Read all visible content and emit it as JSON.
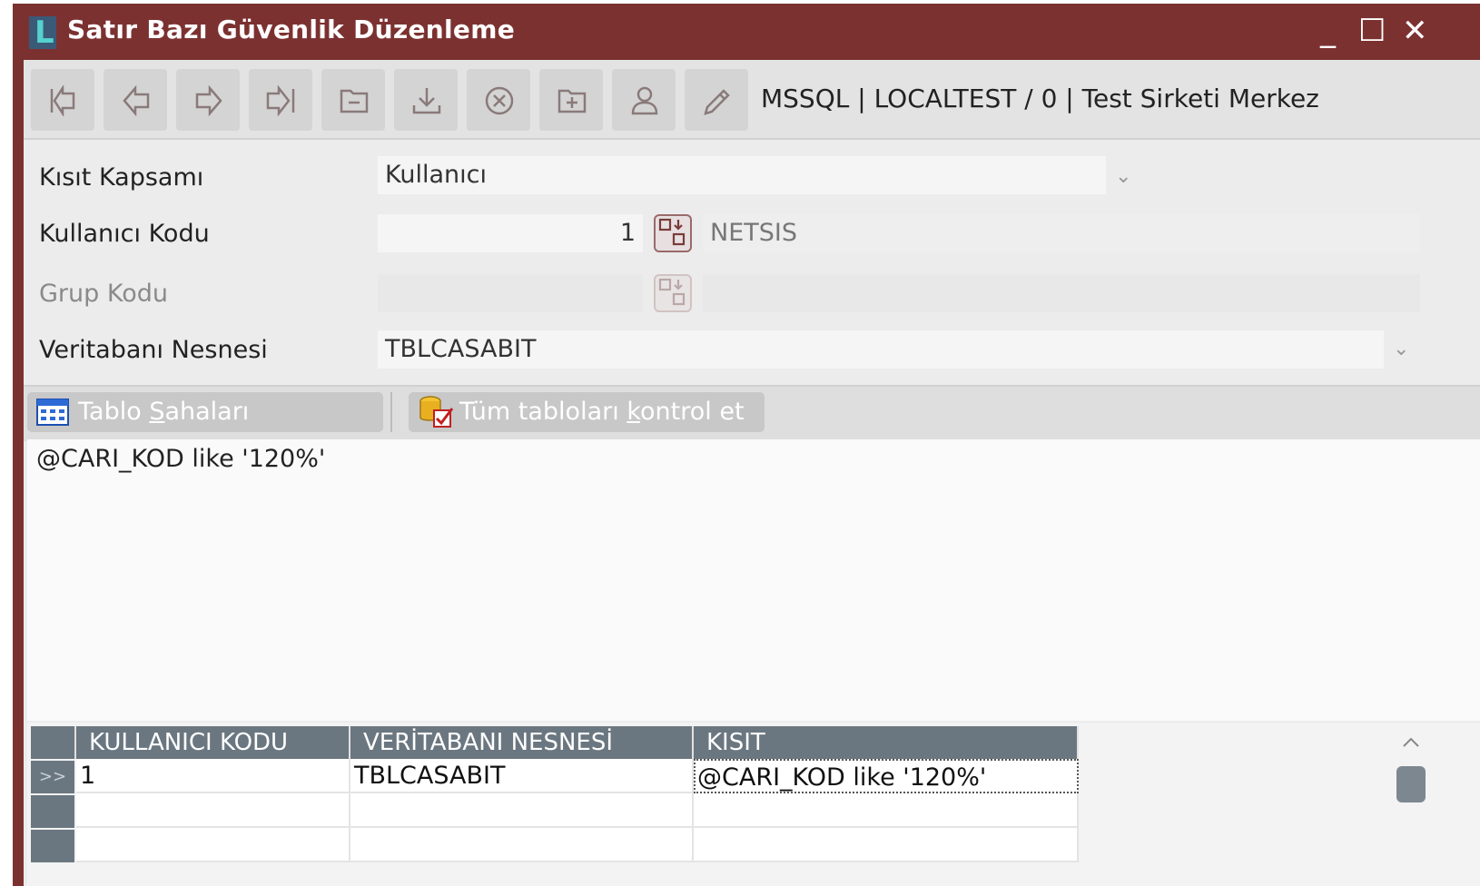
{
  "window": {
    "title": "Satır Bazı Güvenlik Düzenleme",
    "app_logo_letter": "L",
    "controls": {
      "minimize": "_",
      "maximize": "☐",
      "close": "✕"
    }
  },
  "toolbar": {
    "buttons": [
      {
        "name": "first-record",
        "icon": "first-icon"
      },
      {
        "name": "previous-record",
        "icon": "prev-icon"
      },
      {
        "name": "next-record",
        "icon": "next-icon"
      },
      {
        "name": "last-record",
        "icon": "last-icon"
      },
      {
        "name": "delete-record",
        "icon": "folder-minus-icon"
      },
      {
        "name": "save-record",
        "icon": "download-icon"
      },
      {
        "name": "cancel",
        "icon": "x-circle-icon"
      },
      {
        "name": "new-record",
        "icon": "folder-plus-icon"
      },
      {
        "name": "user",
        "icon": "user-icon"
      },
      {
        "name": "edit",
        "icon": "pencil-icon"
      }
    ],
    "connection_info": "MSSQL | LOCALTEST / 0 | Test Sirketi Merkez"
  },
  "form": {
    "kisit_kapsami": {
      "label": "Kısıt Kapsamı",
      "value": "Kullanıcı"
    },
    "kullanici_kodu": {
      "label": "Kullanıcı Kodu",
      "value": "1",
      "name_value": "NETSIS"
    },
    "grup_kodu": {
      "label": "Grup Kodu",
      "value": "",
      "name_value": ""
    },
    "veritabani_nesnesi": {
      "label": "Veritabanı Nesnesi",
      "value": "TBLCASABIT"
    }
  },
  "buttons": {
    "tablo_sahalari": {
      "pre": "Tablo ",
      "accel": "S",
      "post": "ahaları"
    },
    "tum_tablolari": {
      "pre": "Tüm tabloları ",
      "accel": "k",
      "post": "ontrol et"
    }
  },
  "expression": "@CARI_KOD like '120%'",
  "grid": {
    "columns": [
      "KULLANICI KODU",
      "VERİTABANI NESNESİ",
      "KISIT"
    ],
    "rows": [
      {
        "indicator": ">>",
        "cells": [
          "1",
          "TBLCASABIT",
          "@CARI_KOD like '120%'"
        ]
      }
    ]
  },
  "colors": {
    "title_bar": "#7c3131",
    "grid_header": "#6b7780"
  }
}
